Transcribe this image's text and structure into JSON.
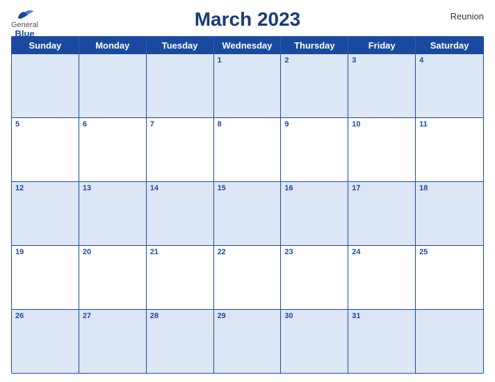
{
  "header": {
    "title": "March 2023",
    "region": "Reunion",
    "logo": {
      "general": "General",
      "blue": "Blue"
    }
  },
  "dayHeaders": [
    "Sunday",
    "Monday",
    "Tuesday",
    "Wednesday",
    "Thursday",
    "Friday",
    "Saturday"
  ],
  "weeks": [
    [
      {
        "num": "",
        "empty": true
      },
      {
        "num": "",
        "empty": true
      },
      {
        "num": "",
        "empty": true
      },
      {
        "num": "1",
        "empty": false
      },
      {
        "num": "2",
        "empty": false
      },
      {
        "num": "3",
        "empty": false
      },
      {
        "num": "4",
        "empty": false
      }
    ],
    [
      {
        "num": "5",
        "empty": false
      },
      {
        "num": "6",
        "empty": false
      },
      {
        "num": "7",
        "empty": false
      },
      {
        "num": "8",
        "empty": false
      },
      {
        "num": "9",
        "empty": false
      },
      {
        "num": "10",
        "empty": false
      },
      {
        "num": "11",
        "empty": false
      }
    ],
    [
      {
        "num": "12",
        "empty": false
      },
      {
        "num": "13",
        "empty": false
      },
      {
        "num": "14",
        "empty": false
      },
      {
        "num": "15",
        "empty": false
      },
      {
        "num": "16",
        "empty": false
      },
      {
        "num": "17",
        "empty": false
      },
      {
        "num": "18",
        "empty": false
      }
    ],
    [
      {
        "num": "19",
        "empty": false
      },
      {
        "num": "20",
        "empty": false
      },
      {
        "num": "21",
        "empty": false
      },
      {
        "num": "22",
        "empty": false
      },
      {
        "num": "23",
        "empty": false
      },
      {
        "num": "24",
        "empty": false
      },
      {
        "num": "25",
        "empty": false
      }
    ],
    [
      {
        "num": "26",
        "empty": false
      },
      {
        "num": "27",
        "empty": false
      },
      {
        "num": "28",
        "empty": false
      },
      {
        "num": "29",
        "empty": false
      },
      {
        "num": "30",
        "empty": false
      },
      {
        "num": "31",
        "empty": false
      },
      {
        "num": "",
        "empty": true
      }
    ]
  ],
  "colors": {
    "header_bg": "#1a4a9e",
    "shaded_bg": "#dce6f5",
    "white_bg": "#ffffff",
    "text_dark": "#1a4a9e",
    "text_white": "#ffffff"
  }
}
